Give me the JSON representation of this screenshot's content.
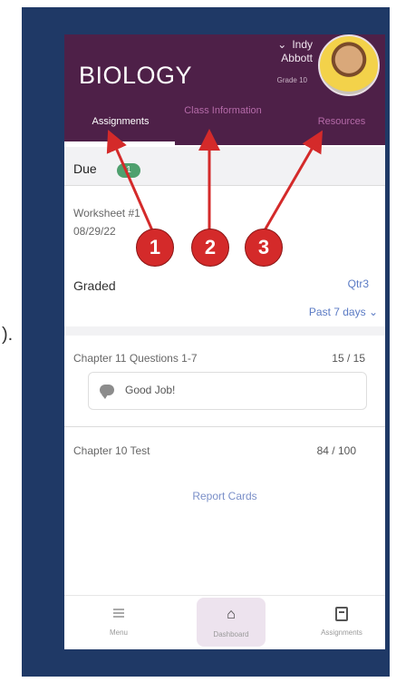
{
  "stray_text": ").",
  "header": {
    "title": "BIOLOGY",
    "user_first": "Indy",
    "user_last": "Abbott",
    "grade": "Grade 10",
    "tabs": [
      "Assignments",
      "Class Information",
      "Resources"
    ]
  },
  "due": {
    "label": "Due",
    "count": "1"
  },
  "worksheet": {
    "title": "Worksheet #1",
    "date": "08/29/22"
  },
  "graded": {
    "label": "Graded",
    "quarter": "Qtr3",
    "range": "Past 7 days"
  },
  "assignments": [
    {
      "name": "Chapter 11 Questions 1-7",
      "score": "15 / 15",
      "comment": "Good Job!"
    },
    {
      "name": "Chapter 10 Test",
      "score": "84 / 100"
    }
  ],
  "report_link": "Report Cards",
  "nav": {
    "menu": "Menu",
    "dashboard": "Dashboard",
    "assignments": "Assignments"
  },
  "markers": [
    "1",
    "2",
    "3"
  ],
  "colors": {
    "header": "#4e2048",
    "frame": "#1f3966",
    "marker": "#d42a2a",
    "badge": "#4fa06e"
  }
}
